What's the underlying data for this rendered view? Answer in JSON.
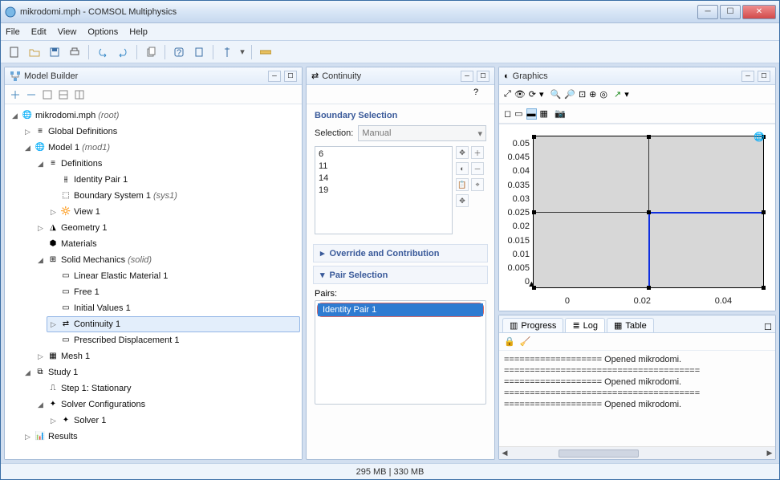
{
  "title": "mikrodomi.mph - COMSOL Multiphysics",
  "menu": [
    "File",
    "Edit",
    "View",
    "Options",
    "Help"
  ],
  "panels": {
    "left": {
      "title": "Model Builder"
    },
    "mid": {
      "title": "Continuity"
    },
    "right": {
      "title": "Graphics"
    }
  },
  "tree": {
    "root": {
      "label": "mikrodomi.mph",
      "ann": "(root)"
    },
    "global": "Global Definitions",
    "model1": {
      "label": "Model 1",
      "ann": "(mod1)"
    },
    "definitions": "Definitions",
    "identity": "Identity Pair 1",
    "boundary_sys": {
      "label": "Boundary System 1",
      "ann": "(sys1)"
    },
    "view": "View 1",
    "geometry": "Geometry 1",
    "materials": "Materials",
    "solid": {
      "label": "Solid Mechanics",
      "ann": "(solid)"
    },
    "lem": "Linear Elastic Material 1",
    "free": "Free 1",
    "iv": "Initial Values 1",
    "continuity": "Continuity 1",
    "presc": "Prescribed Displacement 1",
    "mesh": "Mesh 1",
    "study": "Study 1",
    "step": "Step 1: Stationary",
    "solver_conf": "Solver Configurations",
    "solver": "Solver 1",
    "results": "Results"
  },
  "mid": {
    "boundary_title": "Boundary Selection",
    "selection_label": "Selection:",
    "selection_value": "Manual",
    "boundaries": [
      "6",
      "11",
      "14",
      "19"
    ],
    "override": "Override and Contribution",
    "pair_title": "Pair Selection",
    "pairs_label": "Pairs:",
    "pair_item": "Identity Pair 1"
  },
  "tabs": {
    "progress": "Progress",
    "log": "Log",
    "table": "Table"
  },
  "log": {
    "dash": "===================",
    "l1": "Opened mikrodomi.",
    "l2": "Opened mikrodomi.",
    "l3": "Opened mikrodomi."
  },
  "axis": {
    "y": [
      "0.05",
      "0.045",
      "0.04",
      "0.035",
      "0.03",
      "0.025",
      "0.02",
      "0.015",
      "0.01",
      "0.005",
      "0"
    ],
    "x": [
      "0",
      "0.02",
      "0.04"
    ]
  },
  "status": {
    "mem": "295 MB | 330 MB"
  }
}
